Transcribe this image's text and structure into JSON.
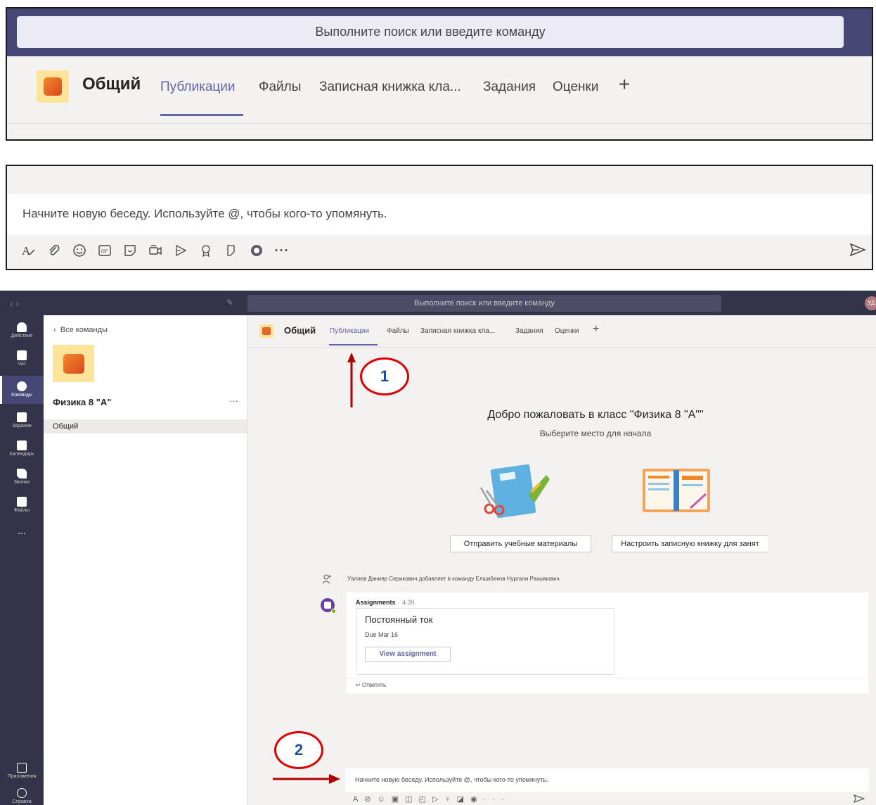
{
  "zoom_header": {
    "search_placeholder": "Выполните поиск или введите команду",
    "team_name": "Общий",
    "tabs": [
      "Публикации",
      "Файлы",
      "Записная книжка кла...",
      "Задания",
      "Оценки",
      "+"
    ]
  },
  "zoom_compose": {
    "placeholder": "Начните новую беседу. Используйте @, чтобы кого-то упомянуть."
  },
  "app": {
    "search_placeholder": "Выполните поиск или введите команду",
    "avatar_initials": "УД",
    "rail": [
      {
        "label": "Действия",
        "icon": "bell-icon"
      },
      {
        "label": "Чат",
        "icon": "chat-icon"
      },
      {
        "label": "Команды",
        "icon": "teams-icon",
        "active": true
      },
      {
        "label": "Задания",
        "icon": "assignments-icon"
      },
      {
        "label": "Календарь",
        "icon": "calendar-icon"
      },
      {
        "label": "Звонки",
        "icon": "phone-icon"
      },
      {
        "label": "Файлы",
        "icon": "files-icon"
      },
      {
        "label": "...",
        "icon": "more-icon"
      }
    ],
    "rail_bottom": [
      {
        "label": "Приложения",
        "icon": "apps-icon"
      },
      {
        "label": "Справка",
        "icon": "help-icon"
      }
    ],
    "sidebar": {
      "back_label": "Все команды",
      "team_name": "Физика 8 \"А\"",
      "more": "···",
      "channel": "Общий"
    },
    "header": {
      "team_name": "Общий",
      "tabs": [
        "Публикации",
        "Файлы",
        "Записная книжка кла...",
        "Задания",
        "Оценки",
        "+"
      ]
    },
    "welcome": {
      "title": "Добро пожаловать в класс \"Физика 8 \"А\"\"",
      "subtitle": "Выберите место для начала",
      "button_materials": "Отправить учебные материалы",
      "button_notebook": "Настроить записную книжку для занят"
    },
    "activity": {
      "text": "Уалиев Данияр Серикович добавляет в команду Елшибеков Нургали Рахымович."
    },
    "post": {
      "author": "Assignments",
      "time": "4:39",
      "card_title": "Постоянный ток",
      "due": "Due Mar 16",
      "view_button": "View assignment",
      "reply": "Ответить"
    },
    "compose": {
      "placeholder": "Начните новую беседу. Используйте @, чтобы кого-то упомянуть."
    }
  },
  "annotations": {
    "marker1": "1",
    "marker2": "2",
    "marker_ring_color": "#e00000",
    "marker_text_color": "#1a4fa0",
    "arrow_color": "#b00000"
  },
  "colors": {
    "accent": "#6264a7",
    "rail_bg": "#33344a",
    "team_icon_bg": "#fde49a"
  }
}
